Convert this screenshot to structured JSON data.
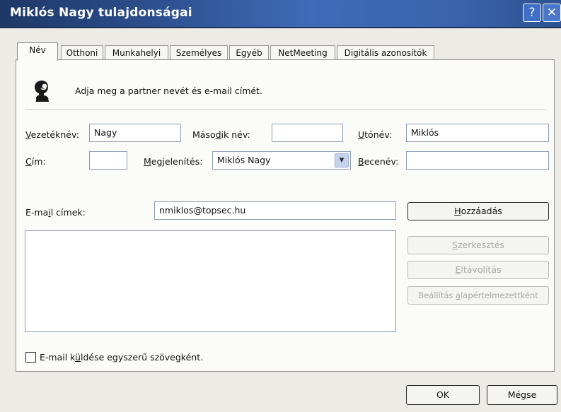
{
  "window": {
    "title": "Miklós Nagy tulajdonságai",
    "help_glyph": "?",
    "close_glyph": "✕"
  },
  "tabs": [
    "Név",
    "Otthoni",
    "Munkahelyi",
    "Személyes",
    "Egyéb",
    "NetMeeting",
    "Digitális azonosítók"
  ],
  "active_tab": "Név",
  "header": {
    "icon": "person-head-icon",
    "instruction": "Adja meg a partner nevét és e-mail címét."
  },
  "fields": {
    "vezeteknev": {
      "label_u": "V",
      "label_rest": "ezetéknév:",
      "value": "Nagy"
    },
    "masodik_nev": {
      "label_pre": "Máso",
      "label_u": "d",
      "label_rest": "ik név:",
      "value": ""
    },
    "utonev": {
      "label_u": "U",
      "label_rest": "tónév:",
      "value": "Miklós"
    },
    "cim": {
      "label_u": "C",
      "label_rest": "ím:",
      "value": ""
    },
    "megjelenites": {
      "label_u": "M",
      "label_rest": "egjelenítés:",
      "value": "Miklós Nagy"
    },
    "becenev": {
      "label_u": "B",
      "label_rest": "ecenév:",
      "value": ""
    },
    "email": {
      "label_pre": "E-ma",
      "label_u": "i",
      "label_rest": "l címek:",
      "value": "nmiklos@topsec.hu"
    }
  },
  "email_list": [],
  "buttons": {
    "add": {
      "label_u": "H",
      "label_rest": "ozzáadás"
    },
    "edit": {
      "label_u": "S",
      "label_rest": "zerkesztés"
    },
    "remove": {
      "label_u": "E",
      "label_rest": "ltávolítás"
    },
    "set_default": {
      "label_pre": "Beállítás ",
      "label_u": "a",
      "label_rest": "lapértelmezettként"
    },
    "ok": "OK",
    "cancel": "Mégse"
  },
  "checkbox": {
    "label_pre": "E-mail k",
    "label_u": "ü",
    "label_rest": "ldése egyszerű szövegként.",
    "checked": false
  }
}
